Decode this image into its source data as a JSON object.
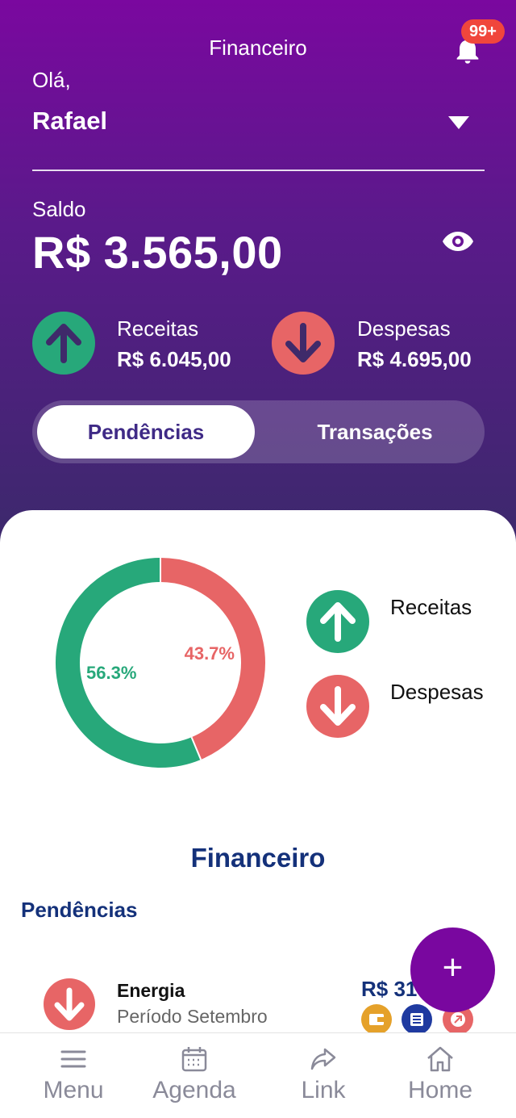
{
  "header": {
    "title": "Financeiro",
    "notification_badge": "99+",
    "greeting": "Olá,",
    "user_name": "Rafael",
    "balance_label": "Saldo",
    "balance_value": "R$ 3.565,00"
  },
  "stats": {
    "income_label": "Receitas",
    "income_value": "R$ 6.045,00",
    "expense_label": "Despesas",
    "expense_value": "R$ 4.695,00"
  },
  "tabs": {
    "pending_label": "Pendências",
    "transactions_label": "Transações",
    "active": "Pendências"
  },
  "chart_data": {
    "type": "pie",
    "categories": [
      "Receitas",
      "Despesas"
    ],
    "values": [
      56.3,
      43.7
    ],
    "labels": [
      "56.3%",
      "43.7%"
    ],
    "colors": [
      "#27a87a",
      "#e76566"
    ]
  },
  "legend": {
    "income_label": "Receitas",
    "expense_label": "Despesas"
  },
  "section": {
    "title": "Financeiro",
    "subtitle": "Pendências"
  },
  "list": {
    "items": [
      {
        "title": "Energia",
        "subtitle": "Período Setembro",
        "amount": "R$ 31"
      }
    ]
  },
  "fab": {
    "label": "+"
  },
  "nav": {
    "menu": "Menu",
    "agenda": "Agenda",
    "link": "Link",
    "home": "Home"
  },
  "colors": {
    "income": "#27a87a",
    "expense": "#e76566",
    "primary": "#79079f",
    "navy": "#14317a"
  }
}
